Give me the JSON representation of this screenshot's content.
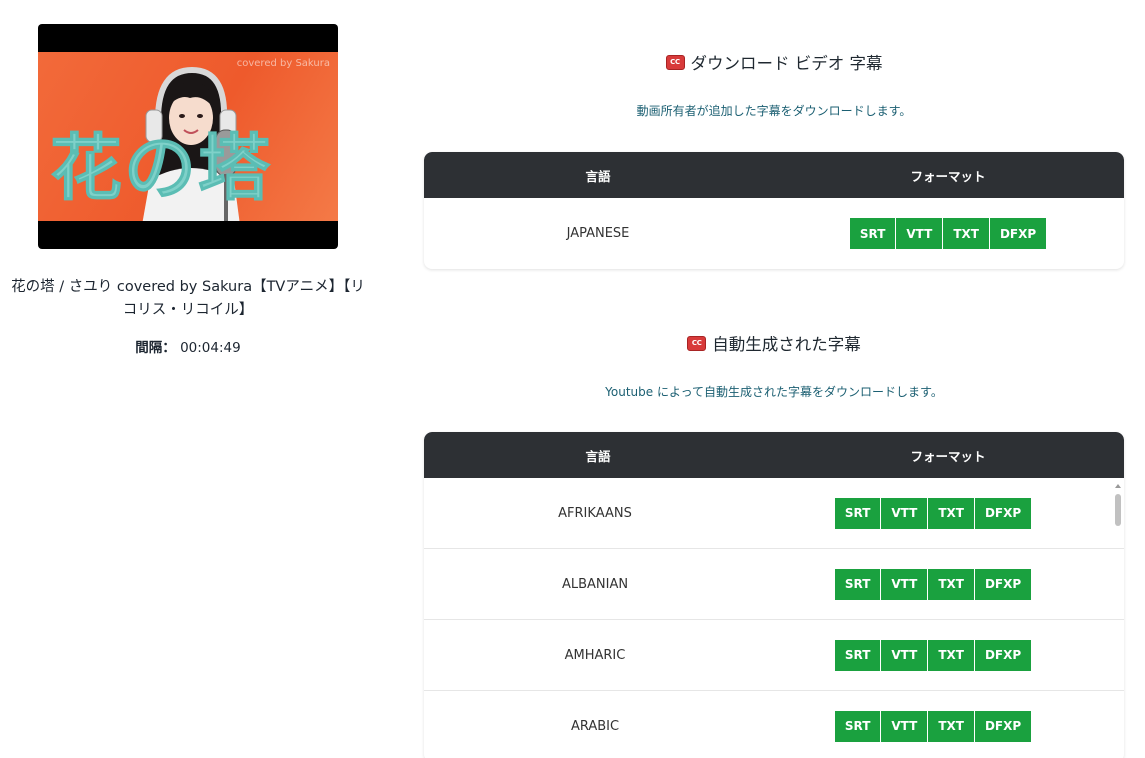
{
  "video": {
    "thumbnail_overlay_text": "covered by Sakura",
    "thumbnail_title_text": "花の塔",
    "title": "花の塔 / さユり covered by Sakura【TVアニメ】【リコリス・リコイル】",
    "duration_label": "間隔：",
    "duration_value": "00:04:49"
  },
  "owner_section": {
    "icon": "cc-icon",
    "title": "ダウンロード ビデオ 字幕",
    "description": "動画所有者が追加した字幕をダウンロードします。",
    "headers": {
      "language": "言語",
      "format": "フォーマット"
    },
    "rows": [
      {
        "language": "JAPANESE"
      }
    ]
  },
  "auto_section": {
    "icon": "cc-icon",
    "title": "自動生成された字幕",
    "description": "Youtube によって自動生成された字幕をダウンロードします。",
    "headers": {
      "language": "言語",
      "format": "フォーマット"
    },
    "rows": [
      {
        "language": "AFRIKAANS"
      },
      {
        "language": "ALBANIAN"
      },
      {
        "language": "AMHARIC"
      },
      {
        "language": "ARABIC"
      }
    ]
  },
  "formats": [
    "SRT",
    "VTT",
    "TXT",
    "DFXP"
  ],
  "colors": {
    "header_bg": "#2d3034",
    "button_green": "#1aa13f",
    "cc_red": "#d83a3a",
    "description_text": "#1b5f72"
  }
}
